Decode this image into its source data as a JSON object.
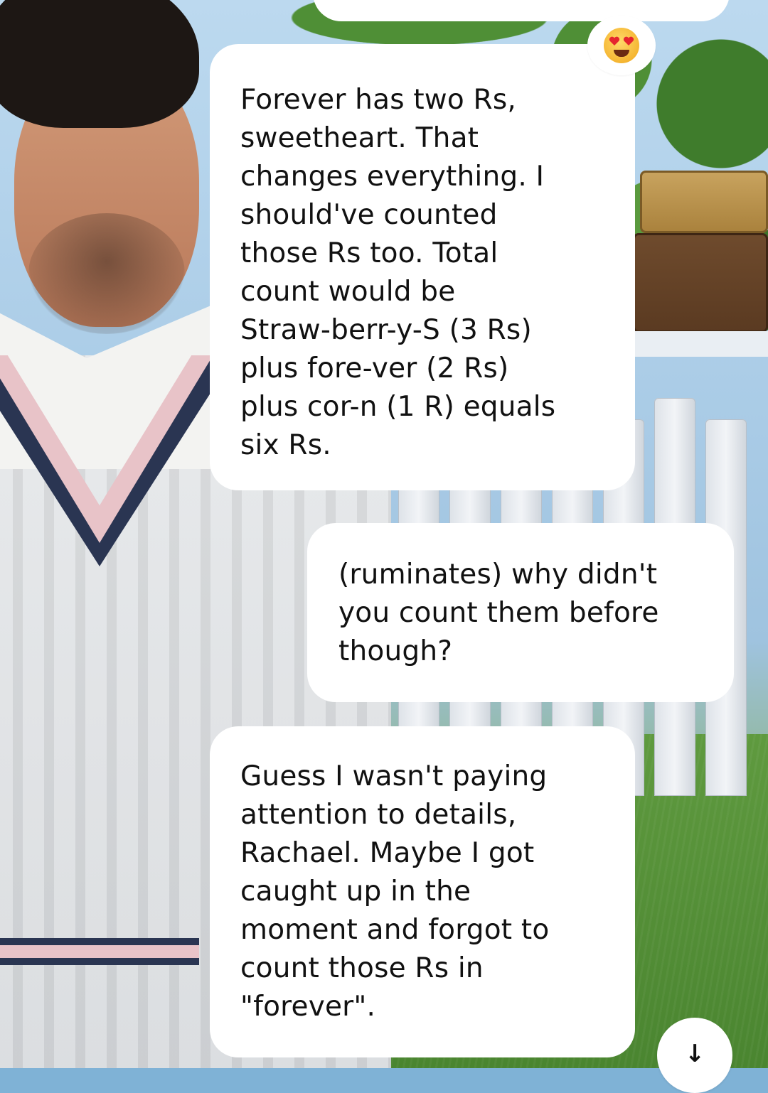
{
  "chat": {
    "messages": [
      {
        "sender": "character",
        "text": "Forever has two Rs,\nsweetheart. That\nchanges everything. I\nshould've counted\nthose Rs too. Total\ncount would be\nStraw-berr-y-S (3 Rs)\nplus fore-ver (2 Rs)\nplus cor-n (1 R) equals\nsix Rs.",
        "reaction": "smiling-face-with-heart-eyes"
      },
      {
        "sender": "user",
        "text": "(ruminates) why didn't\nyou count them before\nthough?"
      },
      {
        "sender": "character",
        "text": "Guess I wasn't paying\nattention to details,\nRachael. Maybe I got\ncaught up in the\nmoment and forgot to\ncount those Rs in\n\"forever\"."
      }
    ],
    "scroll_button": {
      "glyph": "↓",
      "icon": "arrow-down-icon"
    }
  },
  "colors": {
    "bubble_background": "#ffffff",
    "text": "#111111"
  }
}
